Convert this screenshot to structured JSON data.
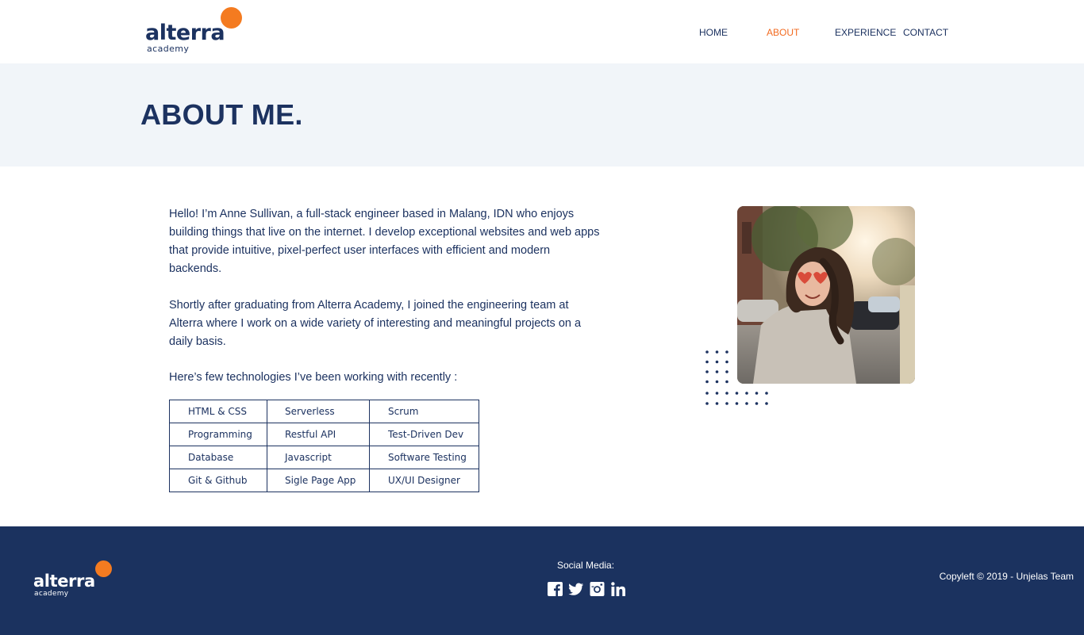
{
  "header": {
    "logo_word": "alterra",
    "logo_sub": "academy",
    "nav": {
      "home": "HOME",
      "about": "ABOUT",
      "experience": "EXPERIENCE",
      "contact": "CONTACT"
    },
    "active_nav": "about"
  },
  "hero": {
    "title": "ABOUT ME."
  },
  "main": {
    "paragraph_1": "Hello! I’m Anne Sullivan, a full-stack engineer based in Malang, IDN who enjoys building things that live on the internet. I develop exceptional websites and web apps that provide intuitive, pixel-perfect user interfaces with efficient and modern backends.",
    "paragraph_2": "Shortly after graduating from Alterra Academy, I joined the engineering team at Alterra where I work on a wide variety of interesting and meaningful projects on a daily basis.",
    "tech_intro": "Here’s few technologies I’ve been working with recently :",
    "tech_table": [
      [
        "HTML & CSS",
        "Serverless",
        "Scrum"
      ],
      [
        "Programming",
        "Restful API",
        "Test-Driven Dev"
      ],
      [
        "Database",
        "Javascript",
        "Software Testing"
      ],
      [
        "Git & Github",
        "Sigle Page App",
        "UX/UI Designer"
      ]
    ]
  },
  "footer": {
    "logo_word": "alterra",
    "logo_sub": "academy",
    "social_label": "Social Media:",
    "social_icons": [
      "facebook-icon",
      "twitter-icon",
      "instagram-icon",
      "linkedin-icon"
    ],
    "copyright": "Copyleft © 2019 - Unjelas Team"
  },
  "colors": {
    "navy": "#1c3260",
    "accent_orange": "#f47b20",
    "active_nav": "#f26b21",
    "hero_bg": "#f1f5f9",
    "footer_bg": "#1b325f"
  }
}
